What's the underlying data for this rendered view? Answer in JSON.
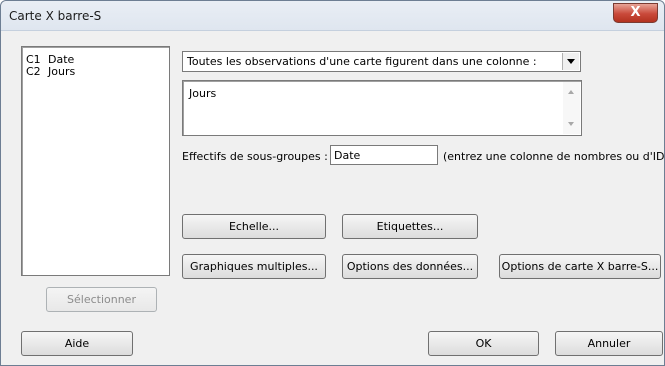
{
  "window": {
    "title": "Carte X barre-S",
    "close_label": "X"
  },
  "columns": [
    {
      "id": "C1",
      "name": "Date"
    },
    {
      "id": "C2",
      "name": "Jours"
    }
  ],
  "select_button": "Sélectionner",
  "data_layout": {
    "selected": "Toutes les observations d'une carte figurent dans une colonne :"
  },
  "variables": {
    "value": "Jours"
  },
  "subgroup": {
    "label": "Effectifs de sous-groupes :",
    "value": "Date",
    "hint": "(entrez une colonne de nombres ou d'ID)"
  },
  "buttons": {
    "scale": "Echelle...",
    "labels": "Etiquettes...",
    "multiple_graphs": "Graphiques multiples...",
    "data_options": "Options des données...",
    "chart_options": "Options de carte X barre-S..."
  },
  "footer": {
    "help": "Aide",
    "ok": "OK",
    "cancel": "Annuler"
  }
}
